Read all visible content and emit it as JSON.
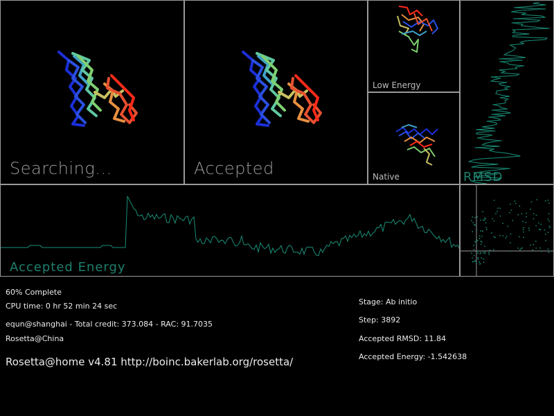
{
  "panels": {
    "searching": {
      "label": "Searching..."
    },
    "accepted": {
      "label": "Accepted"
    },
    "low_energy": {
      "label": "Low  Energy"
    },
    "native": {
      "label": "Native"
    },
    "rmsd": {
      "label": "RMSD"
    },
    "accepted_energy": {
      "label": "Accepted  Energy"
    }
  },
  "status": {
    "percent_complete": "60%  Complete",
    "cpu_time": "CPU  time:  0  hr  52  min  24  sec",
    "credit_line": "equn@shanghai  -  Total  credit:  373.084  -  RAC:  91.7035",
    "team": "Rosetta@China",
    "app_version": "Rosetta@home   v4.81    http://boinc.bakerlab.org/rosetta/"
  },
  "stats": {
    "stage": "Stage:  Ab  initio",
    "step": "Step:  3892",
    "accepted_rmsd": "Accepted  RMSD:    11.84",
    "accepted_energy": "Accepted  Energy:  -1.542638"
  },
  "colors": {
    "trace": "#1a8f78",
    "border": "#9a9a9a",
    "label_gray": "#9c9c9c"
  }
}
